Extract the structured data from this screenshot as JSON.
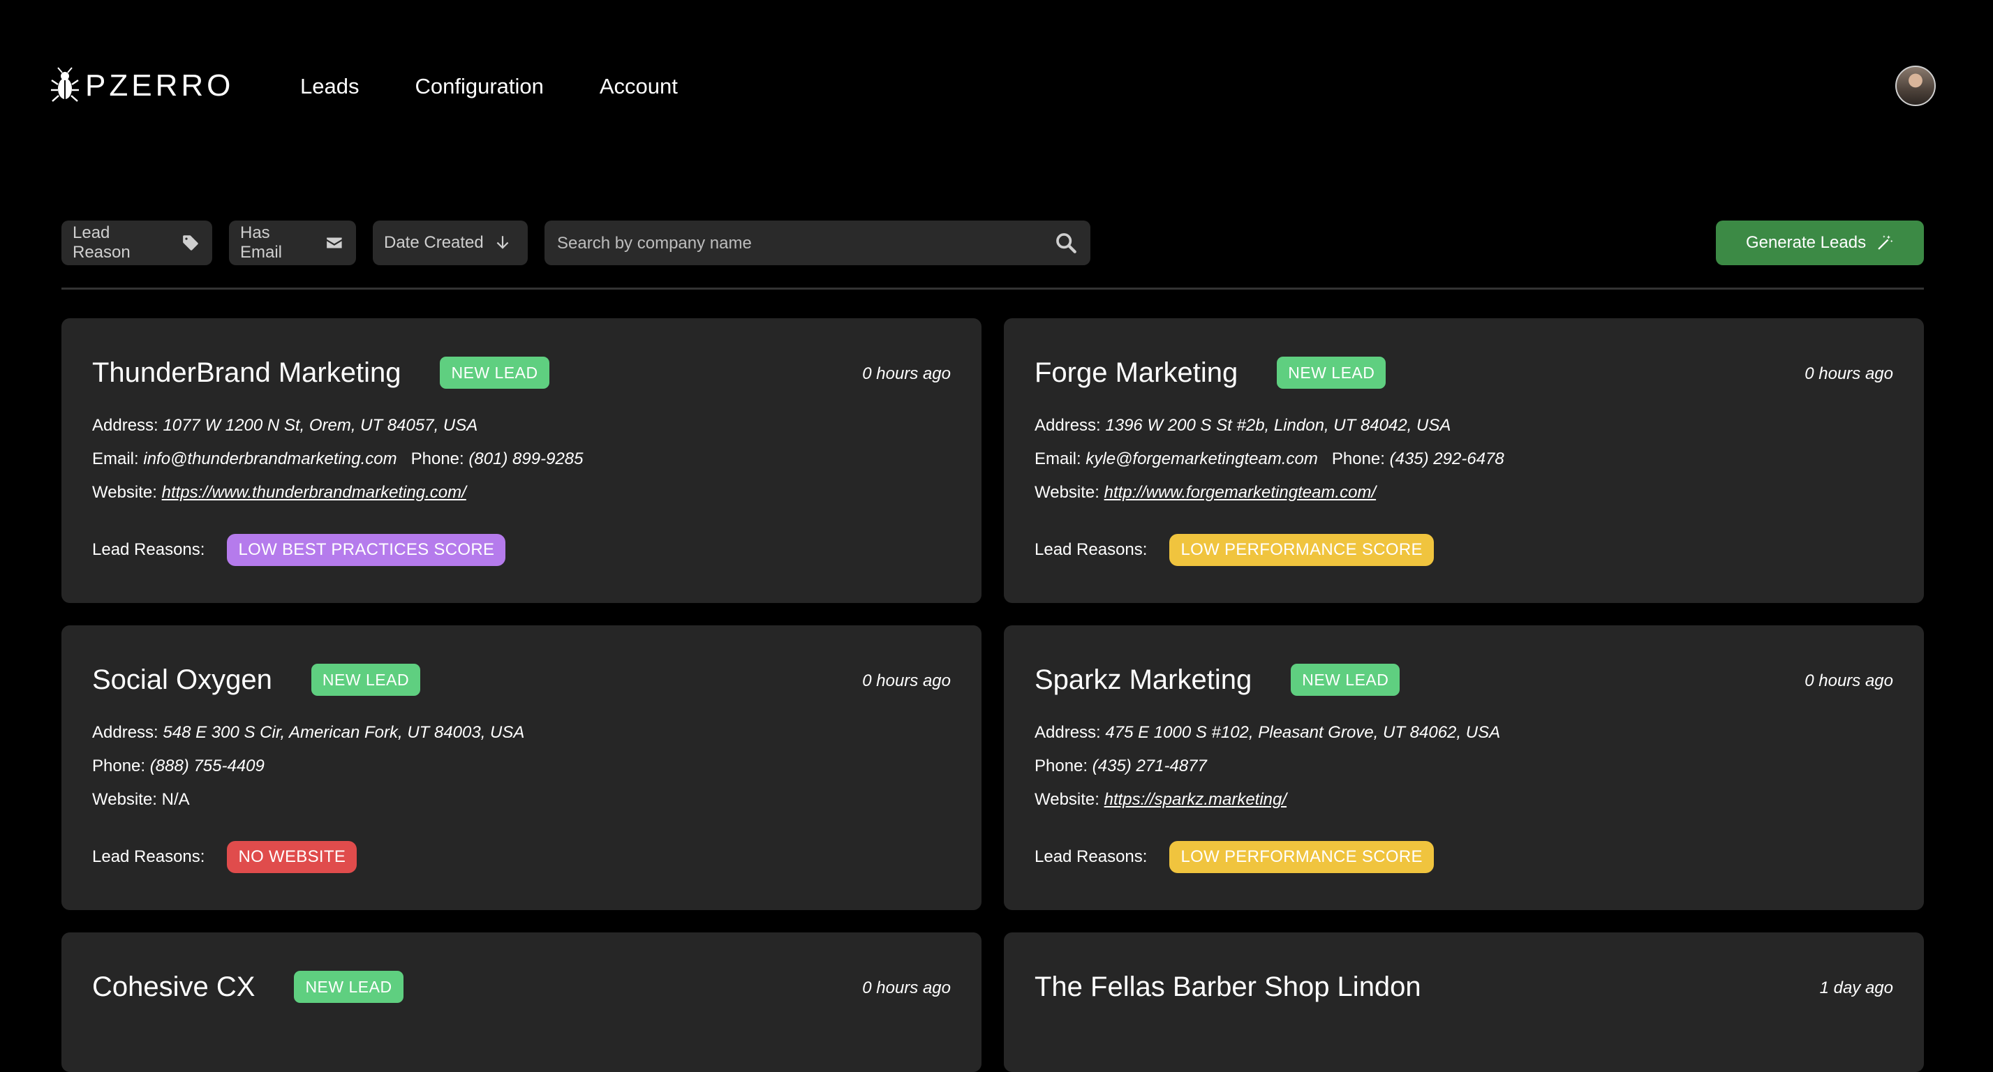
{
  "app": {
    "logo_text": "PZERRO"
  },
  "nav": {
    "items": [
      "Leads",
      "Configuration",
      "Account"
    ]
  },
  "toolbar": {
    "lead_reason_label": "Lead Reason",
    "has_email_label": "Has Email",
    "date_created_label": "Date Created",
    "search_placeholder": "Search by company name",
    "generate_label": "Generate Leads"
  },
  "labels": {
    "address": "Address:",
    "email": "Email:",
    "phone": "Phone:",
    "website": "Website:",
    "lead_reasons": "Lead Reasons:"
  },
  "leads": [
    {
      "name": "ThunderBrand Marketing",
      "status": "NEW LEAD",
      "time": "0 hours ago",
      "address": "1077 W 1200 N St, Orem, UT 84057, USA",
      "email": "info@thunderbrandmarketing.com",
      "phone": "(801) 899-9285",
      "website": "https://www.thunderbrandmarketing.com/",
      "reason": "LOW BEST PRACTICES SCORE",
      "reason_color": "#b57bec"
    },
    {
      "name": "Forge Marketing",
      "status": "NEW LEAD",
      "time": "0 hours ago",
      "address": "1396 W 200 S St #2b, Lindon, UT 84042, USA",
      "email": "kyle@forgemarketingteam.com",
      "phone": "(435) 292-6478",
      "website": "http://www.forgemarketingteam.com/",
      "reason": "LOW PERFORMANCE SCORE",
      "reason_color": "#f0c43e"
    },
    {
      "name": "Social Oxygen",
      "status": "NEW LEAD",
      "time": "0 hours ago",
      "address": "548 E 300 S Cir, American Fork, UT 84003, USA",
      "phone": "(888) 755-4409",
      "website": "N/A",
      "reason": "NO WEBSITE",
      "reason_color": "#e04c4c"
    },
    {
      "name": "Sparkz Marketing",
      "status": "NEW LEAD",
      "time": "0 hours ago",
      "address": "475 E 1000 S #102, Pleasant Grove, UT 84062, USA",
      "phone": "(435) 271-4877",
      "website": "https://sparkz.marketing/",
      "reason": "LOW PERFORMANCE SCORE",
      "reason_color": "#f0c43e"
    },
    {
      "name": "Cohesive CX",
      "status": "NEW LEAD",
      "time": "0 hours ago"
    },
    {
      "name": "The Fellas Barber Shop Lindon",
      "time": "1 day ago"
    }
  ]
}
